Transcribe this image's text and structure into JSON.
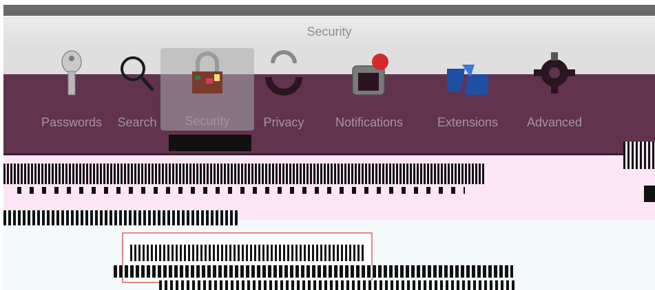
{
  "window": {
    "title": "Security"
  },
  "toolbar": {
    "items": [
      {
        "label": "Passwords",
        "icon": "key-icon"
      },
      {
        "label": "Search",
        "icon": "search-icon"
      },
      {
        "label": "Security",
        "icon": "lock-icon",
        "selected": true
      },
      {
        "label": "Privacy",
        "icon": "privacy-icon"
      },
      {
        "label": "Notifications",
        "icon": "notifications-icon"
      },
      {
        "label": "Extensions",
        "icon": "extensions-icon"
      },
      {
        "label": "Advanced",
        "icon": "gear-icon"
      }
    ]
  },
  "colors": {
    "title_text": "#8c8c8c",
    "toolbar_bg": "#61334e",
    "label_text": "#a493a8",
    "pane_pink": "#fce6f6",
    "pane_bg": "#f4fafc"
  }
}
